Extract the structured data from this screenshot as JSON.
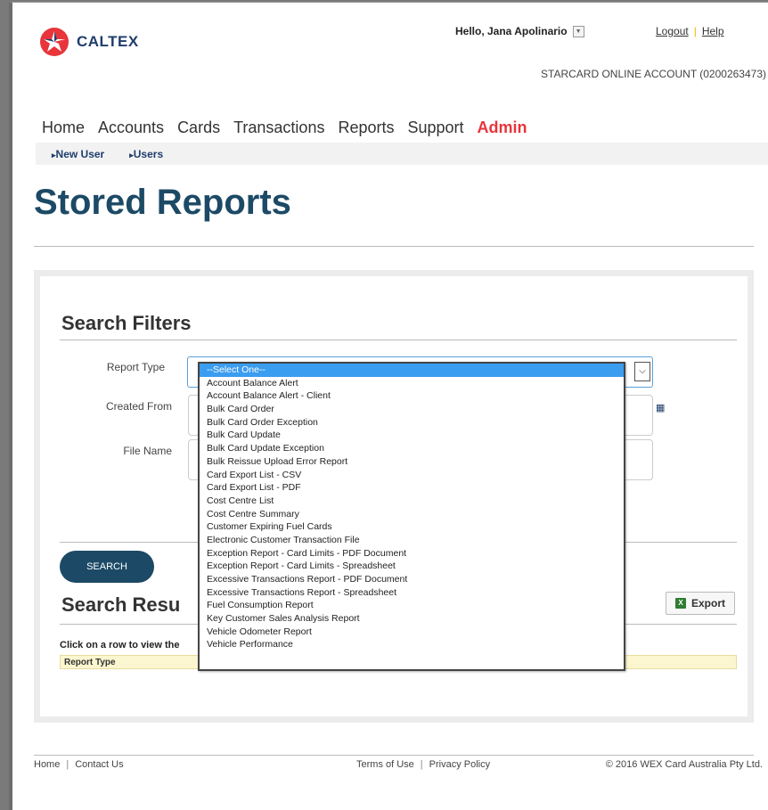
{
  "brand": {
    "name": "CALTEX",
    "logo_colors": [
      "#e8343a",
      "#1f3d6b"
    ]
  },
  "header": {
    "greeting": "Hello, Jana Apolinario",
    "logout": "Logout",
    "help": "Help",
    "account": "STARCARD ONLINE ACCOUNT (0200263473)"
  },
  "nav": {
    "items": [
      "Home",
      "Accounts",
      "Cards",
      "Transactions",
      "Reports",
      "Support"
    ],
    "admin": "Admin",
    "admin_color": "#e8343a"
  },
  "subnav": {
    "items": [
      "New User",
      "Users"
    ]
  },
  "page": {
    "title": "Stored Reports"
  },
  "search_filters": {
    "title": "Search Filters",
    "report_type_label": "Report Type",
    "created_from_label": "Created From",
    "file_name_label": "File Name",
    "search_button": "SEARCH"
  },
  "report_type_dropdown": {
    "selected": "--Select One--",
    "options": [
      "--Select One--",
      "Account Balance Alert",
      "Account Balance Alert - Client",
      "Bulk Card Order",
      "Bulk Card Order Exception",
      "Bulk Card Update",
      "Bulk Card Update Exception",
      "Bulk Reissue Upload Error Report",
      "Card Export List - CSV",
      "Card Export List - PDF",
      "Cost Centre List",
      "Cost Centre Summary",
      "Customer Expiring Fuel Cards",
      "Electronic Customer Transaction File",
      "Exception Report - Card Limits - PDF Document",
      "Exception Report - Card Limits - Spreadsheet",
      "Excessive Transactions Report - PDF Document",
      "Excessive Transactions Report - Spreadsheet",
      "Fuel Consumption Report",
      "Key Customer Sales Analysis Report",
      "Vehicle Odometer Report",
      "Vehicle Performance"
    ]
  },
  "search_results": {
    "title": "Search Resu",
    "export": "Export",
    "hint": "Click on a row to view the",
    "column_report_type": "Report Type"
  },
  "footer": {
    "home": "Home",
    "contact": "Contact Us",
    "terms": "Terms of Use",
    "privacy": "Privacy Policy",
    "copyright": "© 2016 WEX Card Australia Pty Ltd."
  }
}
